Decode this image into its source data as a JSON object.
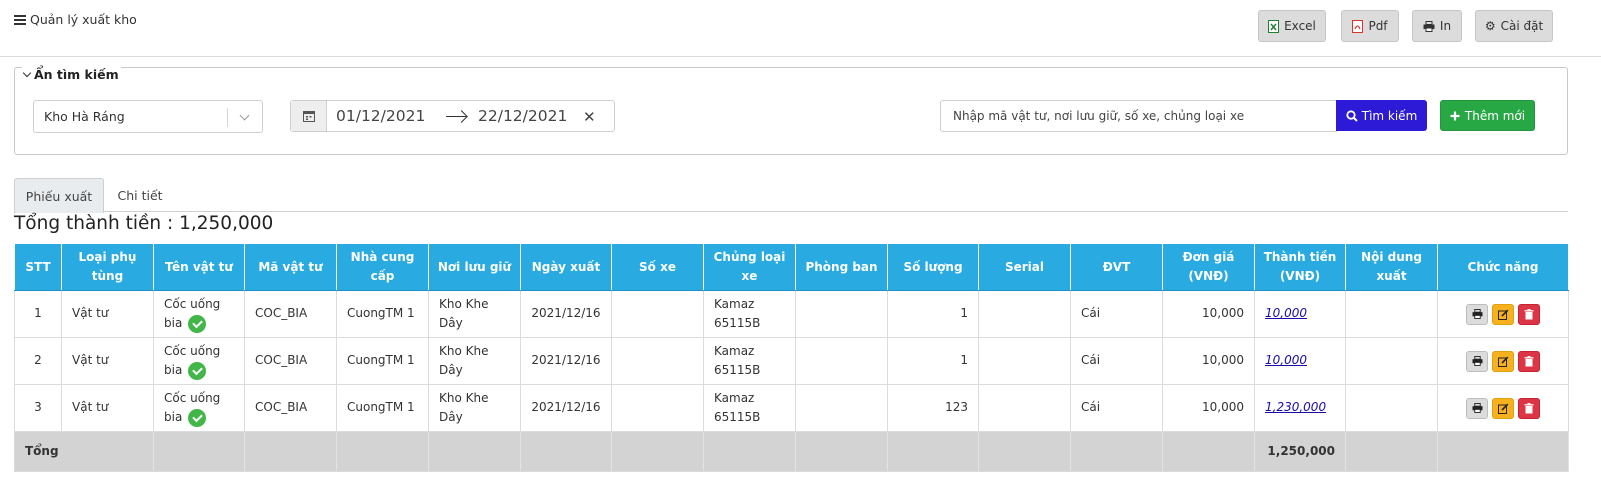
{
  "header": {
    "title": "Quản lý xuất kho",
    "buttons": {
      "excel": "Excel",
      "pdf": "Pdf",
      "print": "In",
      "settings": "Cài đặt"
    }
  },
  "search": {
    "legend": "Ẩn tìm kiếm",
    "warehouse": "Kho Hà Ráng",
    "date_from": "01/12/2021",
    "date_to": "22/12/2021",
    "placeholder": "Nhập mã vật tư, nơi lưu giữ, số xe, chủng loại xe",
    "search_button": "Tìm kiếm",
    "add_button": "Thêm mới"
  },
  "tabs": [
    "Phiếu xuất",
    "Chi tiết"
  ],
  "total_heading": "Tổng thành tiền : 1,250,000",
  "table": {
    "headers": [
      "STT",
      "Loại phụ tùng",
      "Tên vật tư",
      "Mã vật tư",
      "Nhà cung cấp",
      "Nơi lưu giữ",
      "Ngày xuất",
      "Số xe",
      "Chủng loại xe",
      "Phòng ban",
      "Số lượng",
      "Serial",
      "ĐVT",
      "Đơn giá (VNĐ)",
      "Thành tiền (VNĐ)",
      "Nội dung xuất",
      "Chức năng"
    ],
    "rows": [
      {
        "stt": "1",
        "loai": "Vật tư",
        "ten": "Cốc uống bia",
        "ma": "COC_BIA",
        "ncc": "CuongTM 1",
        "noi": "Kho Khe Dây",
        "ngay": "2021/12/16",
        "soxe": "",
        "chungloai": "Kamaz 65115B",
        "phong": "",
        "soluong": "1",
        "serial": "",
        "dvt": "Cái",
        "dongia": "10,000",
        "thanhtien": "10,000",
        "noidung": ""
      },
      {
        "stt": "2",
        "loai": "Vật tư",
        "ten": "Cốc uống bia",
        "ma": "COC_BIA",
        "ncc": "CuongTM 1",
        "noi": "Kho Khe Dây",
        "ngay": "2021/12/16",
        "soxe": "",
        "chungloai": "Kamaz 65115B",
        "phong": "",
        "soluong": "1",
        "serial": "",
        "dvt": "Cái",
        "dongia": "10,000",
        "thanhtien": "10,000",
        "noidung": ""
      },
      {
        "stt": "3",
        "loai": "Vật tư",
        "ten": "Cốc uống bia",
        "ma": "COC_BIA",
        "ncc": "CuongTM 1",
        "noi": "Kho Khe Dây",
        "ngay": "2021/12/16",
        "soxe": "",
        "chungloai": "Kamaz 65115B",
        "phong": "",
        "soluong": "123",
        "serial": "",
        "dvt": "Cái",
        "dongia": "10,000",
        "thanhtien": "1,230,000",
        "noidung": ""
      }
    ],
    "footer_label": "Tổng",
    "footer_total": "1,250,000"
  },
  "colors": {
    "header_bg": "#29aae0",
    "search_button": "#2c1ad6",
    "add_button": "#28a745",
    "edit_button": "#f7b01e",
    "delete_button": "#dc3545",
    "link": "#1a0dab"
  },
  "icons": {
    "menu": "hamburger-icon",
    "excel": "excel-file-icon",
    "pdf": "pdf-file-icon",
    "print": "printer-icon",
    "settings": "gear-icon",
    "calendar": "calendar-icon",
    "search": "search-icon",
    "add": "plus-icon",
    "check": "check-circle-icon",
    "edit": "edit-icon",
    "delete": "trash-icon"
  }
}
